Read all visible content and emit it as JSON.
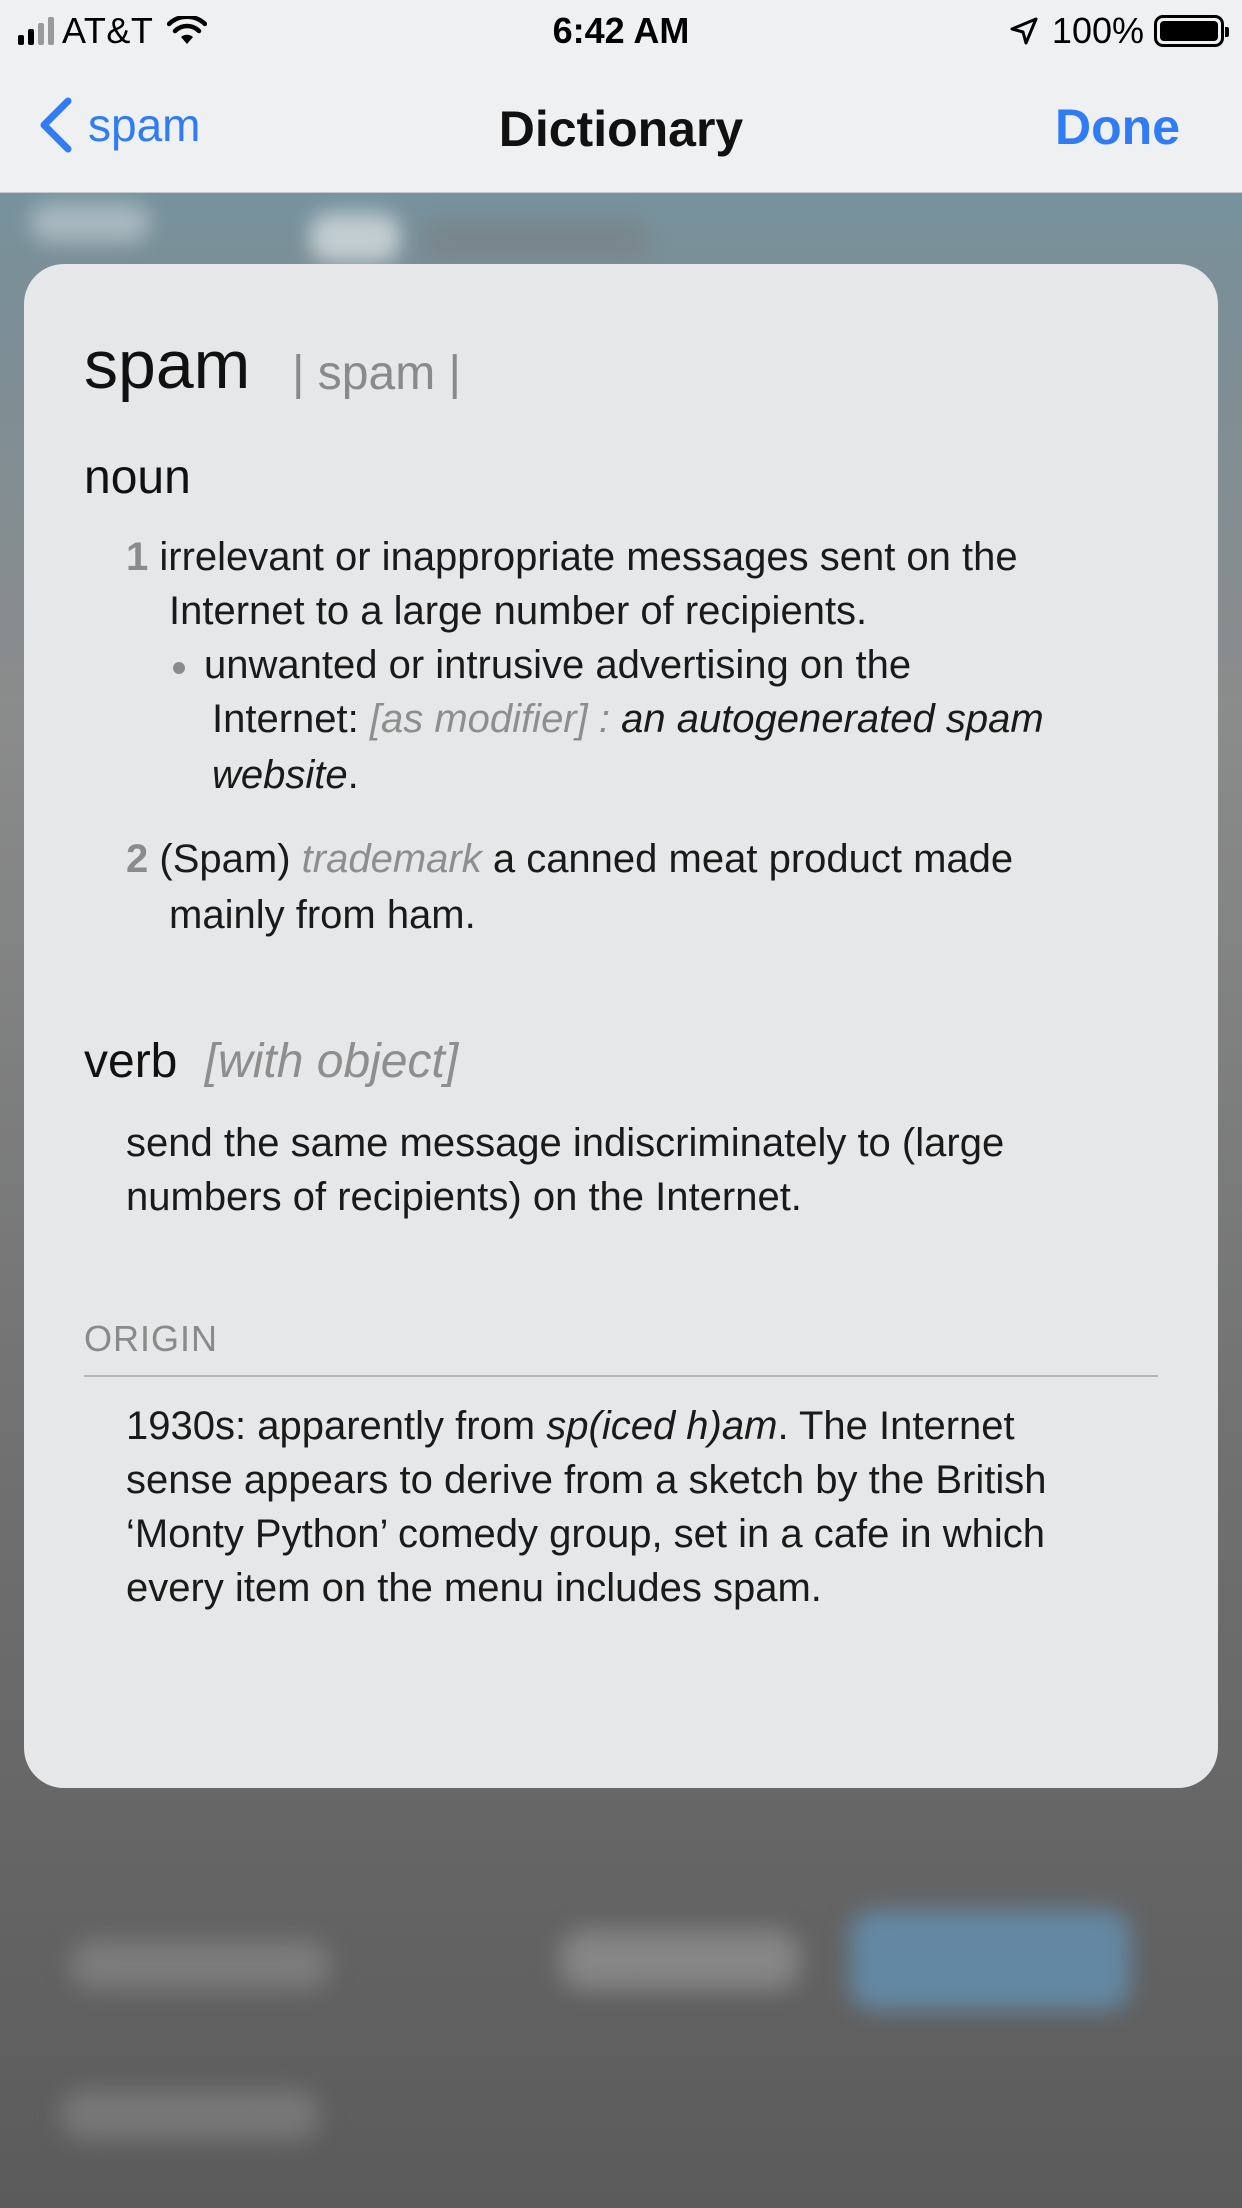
{
  "status_bar": {
    "carrier": "AT&T",
    "time": "6:42 AM",
    "battery_percent": "100%",
    "icons": [
      "signal-icon",
      "wifi-icon",
      "location-arrow-icon",
      "battery-icon"
    ]
  },
  "nav": {
    "back_label": "spam",
    "title": "Dictionary",
    "done_label": "Done",
    "accent_color": "#2f7cf6"
  },
  "entry": {
    "headword": "spam",
    "pronunciation": "| spam |",
    "noun": {
      "label": "noun",
      "senses": [
        {
          "number": "1",
          "text": "irrelevant or inappropriate messages sent on the",
          "text_cont": "Internet to a large number of recipients.",
          "subsense": {
            "text_a": "unwanted or intrusive advertising on the",
            "text_b": "Internet:",
            "grammar": "[as modifier] :",
            "example_a": "an autogenerated spam",
            "example_b": "website",
            "end": "."
          }
        },
        {
          "number": "2",
          "prefix": "(Spam)",
          "label": "trademark",
          "text": "a canned meat product made",
          "text_cont": "mainly from ham."
        }
      ]
    },
    "verb": {
      "label": "verb",
      "grammar": "[with object]",
      "line1": "send the same message indiscriminately to (large",
      "line2": "numbers of recipients) on the Internet."
    },
    "origin": {
      "label": "ORIGIN",
      "line1_a": "1930s: apparently from",
      "line1_it": "sp(iced h)am",
      "line1_b": ". The Internet",
      "line2": "sense appears to derive from a sketch by the British",
      "line3": "‘Monty Python’ comedy group, set in a cafe in which",
      "line4": "every item on the menu includes spam."
    }
  }
}
